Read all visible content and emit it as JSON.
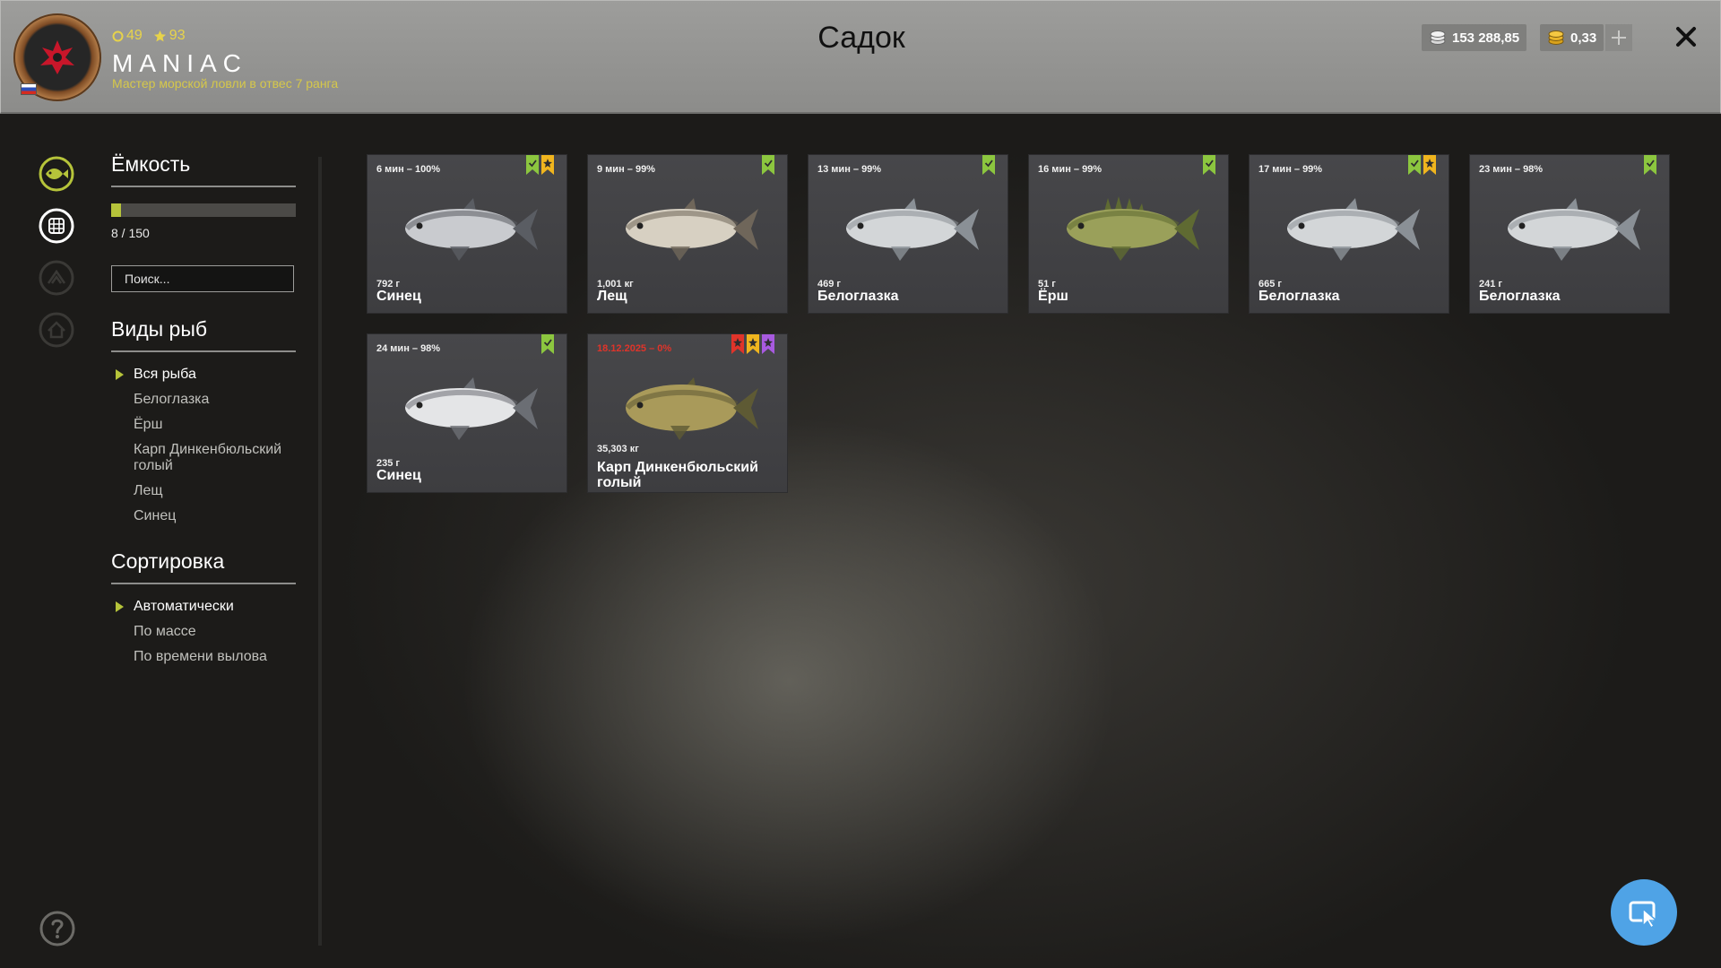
{
  "header": {
    "title": "Садок",
    "player": {
      "name": "MANIAC",
      "rank": "Мастер морской ловли в отвес 7 ранга",
      "level": "49",
      "stars": "93"
    },
    "currency": {
      "silver": "153 288,85",
      "gold": "0,33"
    }
  },
  "capacity": {
    "title": "Ёмкость",
    "text": "8 / 150",
    "fraction": 0.053
  },
  "search": {
    "placeholder": "Поиск..."
  },
  "species": {
    "title": "Виды рыб",
    "items": [
      "Вся рыба",
      "Белоглазка",
      "Ёрш",
      "Карп Динкенбюльский голый",
      "Лещ",
      "Синец"
    ],
    "active": 0
  },
  "sort": {
    "title": "Сортировка",
    "items": [
      "Автоматически",
      "По массе",
      "По времени вылова"
    ],
    "active": 0
  },
  "fish": [
    {
      "time": "6 мин – 100%",
      "weight": "792 г",
      "name": "Синец",
      "badges": [
        "green",
        "gold"
      ],
      "body": "#c9cbcf",
      "back": "#5a5d63"
    },
    {
      "time": "9 мин – 99%",
      "weight": "1,001 кг",
      "name": "Лещ",
      "badges": [
        "green"
      ],
      "body": "#d7d0c2",
      "back": "#6f665a"
    },
    {
      "time": "13 мин – 99%",
      "weight": "469 г",
      "name": "Белоглазка",
      "badges": [
        "green"
      ],
      "body": "#d3d6d8",
      "back": "#8a9096"
    },
    {
      "time": "16 мин – 99%",
      "weight": "51 г",
      "name": "Ёрш",
      "badges": [
        "green"
      ],
      "body": "#9aa05a",
      "back": "#5f6a32"
    },
    {
      "time": "17 мин – 99%",
      "weight": "665 г",
      "name": "Белоглазка",
      "badges": [
        "green",
        "gold"
      ],
      "body": "#d3d6d8",
      "back": "#8a9096"
    },
    {
      "time": "23 мин – 98%",
      "weight": "241 г",
      "name": "Белоглазка",
      "badges": [
        "green"
      ],
      "body": "#d3d6d8",
      "back": "#8a9096"
    },
    {
      "time": "24 мин – 98%",
      "weight": "235 г",
      "name": "Синец",
      "badges": [
        "green"
      ],
      "body": "#e4e5e7",
      "back": "#6b6e74"
    },
    {
      "time": "18.12.2025 – 0%",
      "weight": "35,303 кг",
      "name": "Карп Динкенбюльский голый",
      "badges": [
        "red",
        "gold",
        "purple"
      ],
      "body": "#a99a5a",
      "back": "#5e5a34",
      "expired": true
    }
  ],
  "icons": {
    "rail": [
      "fish-icon",
      "keepnet-icon",
      "rank-icon",
      "home-icon"
    ],
    "help": "help-icon",
    "close": "close-icon",
    "fab": "cursor-icon"
  },
  "colors": {
    "accent": "#b6c43a",
    "gold": "#e7d34a",
    "expired": "#e0342a",
    "badge_green": "#8cc63f",
    "badge_gold": "#f0b51e",
    "badge_red": "#e0342a",
    "badge_purple": "#a85ae0",
    "fab": "#4fa3e6"
  }
}
